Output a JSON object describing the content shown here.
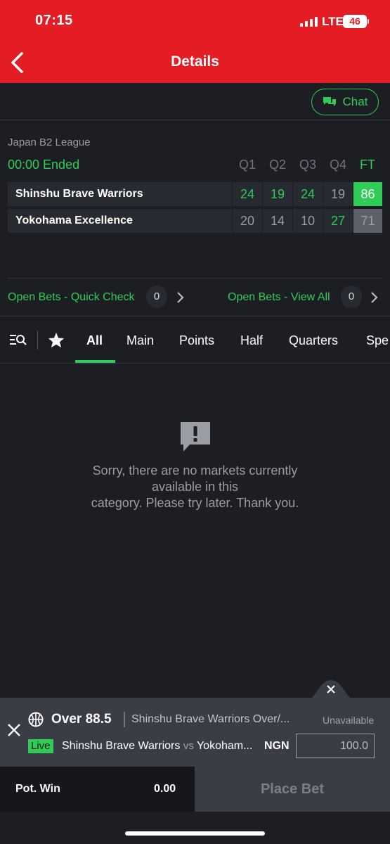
{
  "status_bar": {
    "time": "07:15",
    "network": "LTE",
    "battery": "46"
  },
  "header": {
    "title": "Details"
  },
  "chat": {
    "label": "Chat"
  },
  "event": {
    "league": "Japan B2 League",
    "status": "00:00 Ended",
    "periods": [
      "Q1",
      "Q2",
      "Q3",
      "Q4",
      "FT"
    ],
    "teams": [
      {
        "name": "Shinshu Brave Warriors",
        "scores": [
          "24",
          "19",
          "24",
          "19",
          "86"
        ]
      },
      {
        "name": "Yokohama Excellence",
        "scores": [
          "20",
          "14",
          "10",
          "27",
          "71"
        ]
      }
    ]
  },
  "open_bets": {
    "quick_check_label": "Open Bets - Quick Check",
    "quick_check_count": "0",
    "view_all_label": "Open Bets - View All",
    "view_all_count": "0"
  },
  "tabs": [
    "All",
    "Main",
    "Points",
    "Half",
    "Quarters",
    "Spe"
  ],
  "active_tab": "All",
  "empty_state": {
    "line1": "Sorry, there are no markets currently",
    "line2": "available in this",
    "line3": "category. Please try later. Thank you."
  },
  "betslip": {
    "selection": "Over 88.5",
    "market": "Shinshu Brave Warriors Over/...",
    "availability": "Unavailable",
    "live_badge": "Live",
    "home": "Shinshu Brave Warriors",
    "vs": "vs",
    "away": "Yokoham...",
    "currency": "NGN",
    "stake": "100.0",
    "pot_win_label": "Pot. Win",
    "pot_win_value": "0.00",
    "place_bet_label": "Place Bet"
  },
  "colors": {
    "brand_red": "#e41c23",
    "accent_green": "#2fcd56",
    "background": "#1c1e24"
  }
}
